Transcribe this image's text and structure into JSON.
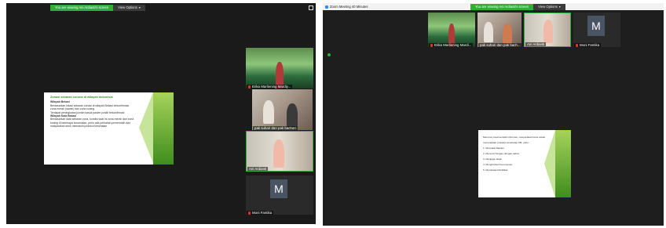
{
  "left": {
    "banner": {
      "sharing": "You are viewing Ani Ardianti's screen",
      "view_options": "View Options"
    },
    "slide": {
      "title": "Zonasi sebaran corona di wilayah Indonesia",
      "lines": [
        "Wilayah Bekasi",
        "Berdasarkan lokasi sebaran zonasi di wilayah Bekasi terkonfirmasi",
        "zona merah (rawan) dan zona kuning",
        "Terdapat peningkatan jumlah kasus pasien positif terkonfirmasi",
        "Wilayah Kota Bekasi",
        "Berdasarkan data sebaran zona, kondisi saat ini zona merah dan zona",
        "kuning di beberapa kecamatan, perlu ada perhatian pemerintah dan",
        "masyarakat untuk mematuhi protokol kesehatan."
      ]
    },
    "participants": [
      {
        "name": "Erika Marliening Mardiy...",
        "type": "video"
      },
      {
        "name": "pak suhari dan pak bachori",
        "type": "video"
      },
      {
        "name": "Ani Ardianti",
        "type": "video"
      },
      {
        "name": "Moni Fantika",
        "type": "avatar",
        "initial": "M"
      }
    ]
  },
  "right": {
    "window_title": "Zoom Meeting 40 Minutes",
    "banner": {
      "sharing": "You are viewing Ani Ardianti's screen",
      "view_options": "View Options"
    },
    "participants": [
      {
        "name": "Erika Marliening Mardi...",
        "type": "video"
      },
      {
        "name": "pak suhari dan pak bach...",
        "type": "video"
      },
      {
        "name": "Ani Ardianti",
        "type": "video"
      },
      {
        "name": "Moni Fantika",
        "type": "avatar",
        "initial": "M"
      }
    ],
    "slide": {
      "lines": [
        "Menurut pusat kendali informasi, masyarakat harus selalu",
        "menerapkan protokol kesehatan 5M, yaitu :",
        "1. Memakai Masker",
        "2. Mencuci Tangan dengan sabun",
        "3. Menjaga Jarak",
        "4. Menghindari Kerumunan",
        "5. Membatasi Mobilitas"
      ]
    }
  },
  "colors": {
    "accent_green": "#2fae3c",
    "slide_green": "#8cc63f",
    "mic_muted": "#e03030"
  }
}
